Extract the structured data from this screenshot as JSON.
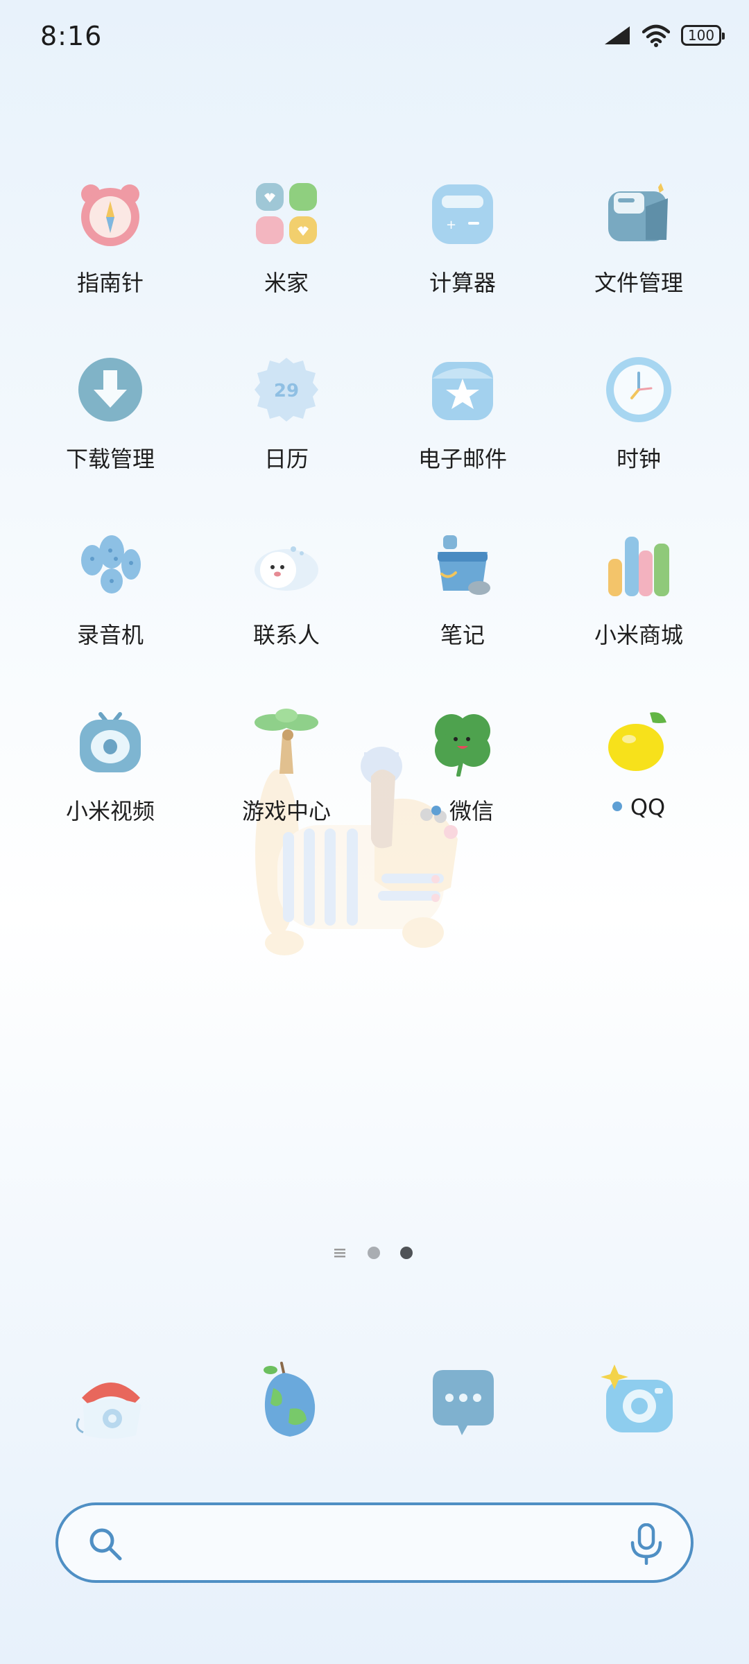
{
  "status_bar": {
    "time": "8:16",
    "battery": "100",
    "icons": [
      "signal-icon",
      "wifi-icon",
      "battery-icon"
    ]
  },
  "apps": [
    {
      "label": "指南针",
      "icon": "compass-icon"
    },
    {
      "label": "米家",
      "icon": "mijia-icon"
    },
    {
      "label": "计算器",
      "icon": "calculator-icon"
    },
    {
      "label": "文件管理",
      "icon": "file-manager-icon"
    },
    {
      "label": "下载管理",
      "icon": "download-icon"
    },
    {
      "label": "日历",
      "icon": "calendar-icon",
      "day": "29"
    },
    {
      "label": "电子邮件",
      "icon": "email-icon"
    },
    {
      "label": "时钟",
      "icon": "clock-icon"
    },
    {
      "label": "录音机",
      "icon": "recorder-icon"
    },
    {
      "label": "联系人",
      "icon": "contacts-icon"
    },
    {
      "label": "笔记",
      "icon": "notes-icon"
    },
    {
      "label": "小米商城",
      "icon": "mi-store-icon"
    },
    {
      "label": "小米视频",
      "icon": "mi-video-icon"
    },
    {
      "label": "游戏中心",
      "icon": "game-center-icon"
    },
    {
      "label": "微信",
      "icon": "wechat-icon",
      "new_badge": true
    },
    {
      "label": "QQ",
      "icon": "qq-icon",
      "new_badge": true
    }
  ],
  "page_indicator": {
    "pages": 2,
    "current": 2
  },
  "dock": [
    {
      "icon": "phone-icon"
    },
    {
      "icon": "browser-icon"
    },
    {
      "icon": "messages-icon"
    },
    {
      "icon": "camera-icon"
    }
  ],
  "search": {
    "placeholder": "",
    "icon": "search-icon",
    "voice_icon": "microphone-icon"
  },
  "colors": {
    "accent": "#4f8fc4",
    "badge_dot": "#5e9fd4"
  }
}
